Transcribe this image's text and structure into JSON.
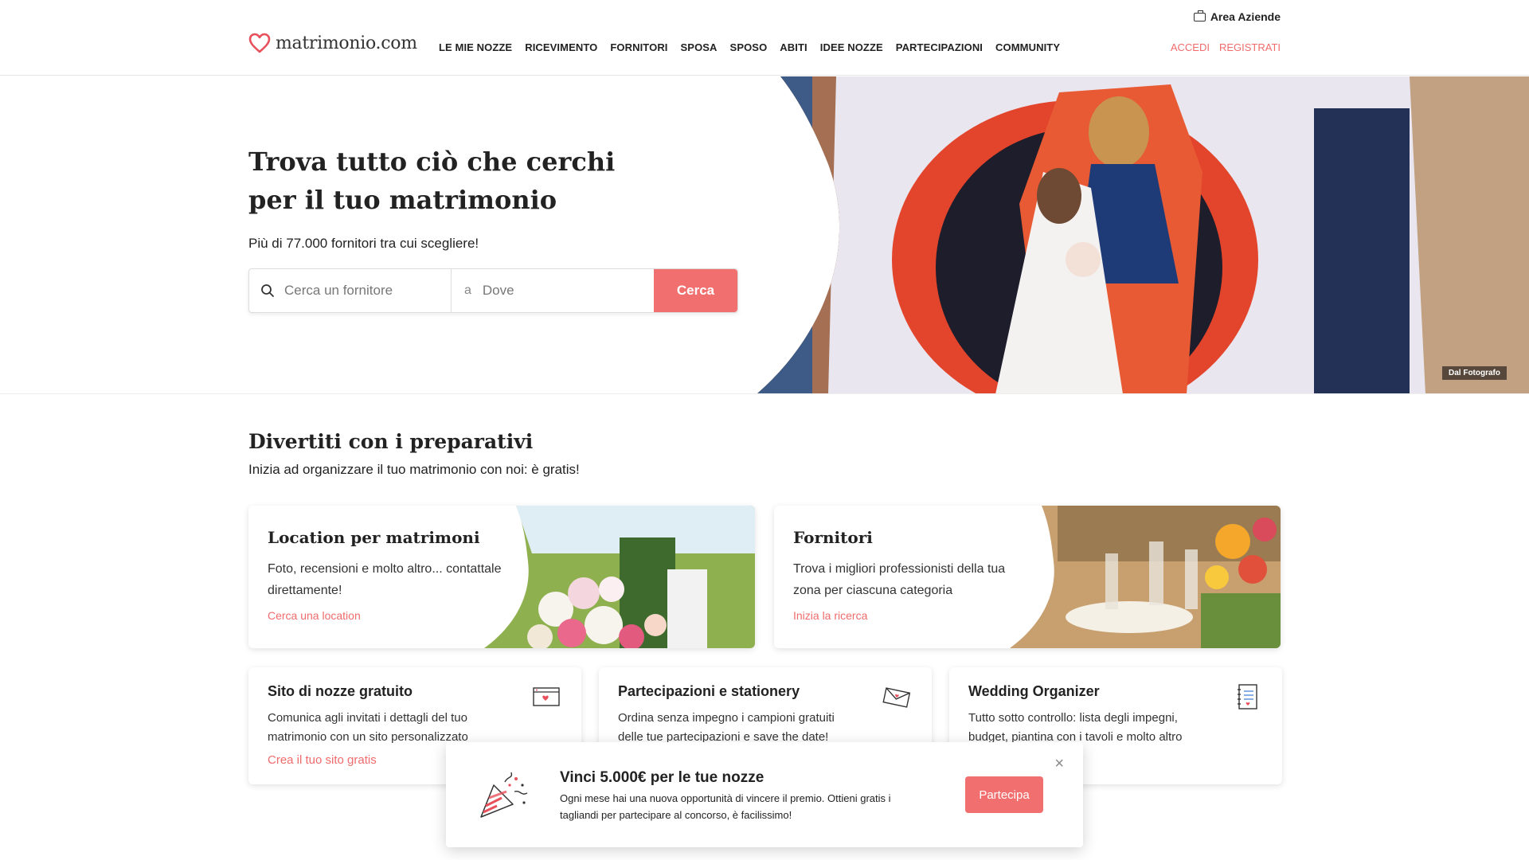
{
  "header": {
    "area_aziende": "Area Aziende",
    "brand": "matrimonio.com",
    "nav": [
      "LE MIE NOZZE",
      "RICEVIMENTO",
      "FORNITORI",
      "SPOSA",
      "SPOSO",
      "ABITI",
      "IDEE NOZZE",
      "PARTECIPAZIONI",
      "COMMUNITY"
    ],
    "login": "ACCEDI",
    "register": "REGISTRATI"
  },
  "hero": {
    "title": "Trova tutto ciò che cerchi per il tuo matrimonio",
    "subtitle": "Più di 77.000 fornitori tra cui scegliere!",
    "search_placeholder": "Cerca un fornitore",
    "where_prefix": "a",
    "where_placeholder": "Dove",
    "search_button": "Cerca",
    "photo_credit": "Dal Fotografo"
  },
  "section": {
    "title": "Divertiti con i preparativi",
    "subtitle": "Inizia ad organizzare il tuo matrimonio con noi: è gratis!"
  },
  "big_cards": [
    {
      "title": "Location per matrimoni",
      "desc": "Foto, recensioni e molto altro... contattale direttamente!",
      "link": "Cerca una location"
    },
    {
      "title": "Fornitori",
      "desc": "Trova i migliori professionisti della tua zona per ciascuna categoria",
      "link": "Inizia la ricerca"
    }
  ],
  "small_cards": [
    {
      "title": "Sito di nozze gratuito",
      "desc": "Comunica agli invitati i dettagli del tuo matrimonio con un sito personalizzato",
      "link": "Crea il tuo sito gratis"
    },
    {
      "title": "Partecipazioni e stationery",
      "desc": "Ordina senza impegno i campioni gratuiti delle tue partecipazioni e save the date!",
      "link": ""
    },
    {
      "title": "Wedding Organizer",
      "desc": "Tutto sotto controllo: lista degli impegni, budget, piantina con i tavoli e molto altro",
      "link": ""
    }
  ],
  "popup": {
    "title": "Vinci 5.000€ per le tue nozze",
    "desc": "Ogni mese hai una nuova opportunità di vincere il premio. Ottieni gratis i tagliandi per partecipare al concorso, è facilissimo!",
    "button": "Partecipa",
    "close": "×"
  },
  "colors": {
    "accent": "#f26f6f",
    "text": "#222222"
  }
}
